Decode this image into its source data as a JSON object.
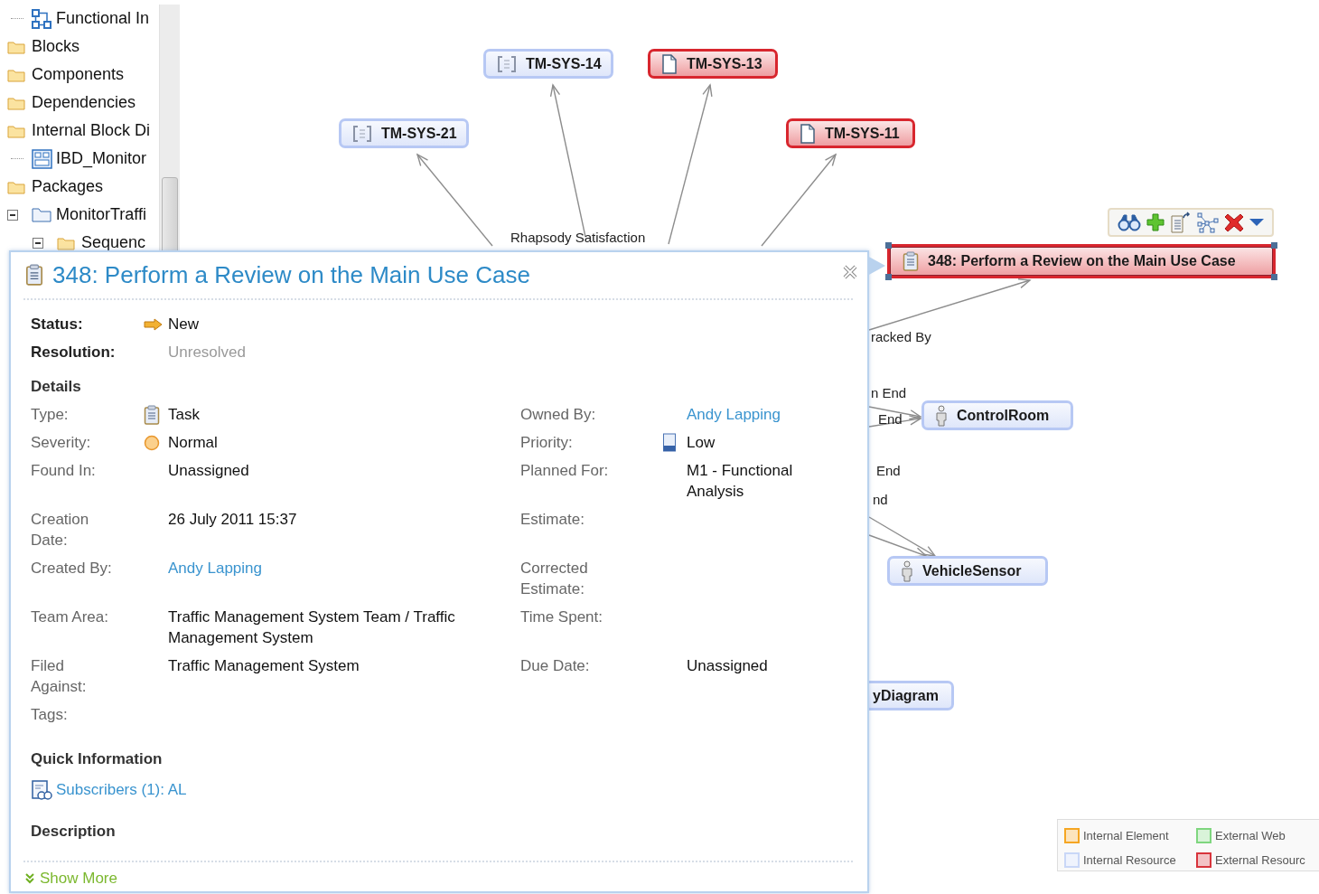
{
  "project_tree": {
    "leading_children": [
      {
        "label": "Functional In",
        "kind": "diagram"
      }
    ],
    "items": [
      {
        "label": "Blocks",
        "kind": "folder"
      },
      {
        "label": "Components",
        "kind": "folder"
      },
      {
        "label": "Dependencies",
        "kind": "folder"
      },
      {
        "label": "Internal Block Di",
        "kind": "folder",
        "children": [
          {
            "label": "IBD_Monitor",
            "kind": "block_diagram"
          }
        ]
      },
      {
        "label": "Packages",
        "kind": "folder",
        "children": [
          {
            "label": "MonitorTraffi",
            "kind": "package",
            "expanded": true,
            "children": [
              {
                "label": "Sequenc",
                "kind": "folder",
                "expanded": true
              }
            ]
          }
        ]
      }
    ]
  },
  "diagram": {
    "nodes": [
      {
        "label": "TM-SYS-14",
        "kind": "requirement",
        "color": "#b7c8f4",
        "selected": false
      },
      {
        "label": "TM-SYS-13",
        "kind": "document",
        "color": "#d8262e",
        "selected": false
      },
      {
        "label": "TM-SYS-21",
        "kind": "requirement",
        "color": "#b7c8f4",
        "selected": false
      },
      {
        "label": "TM-SYS-11",
        "kind": "document",
        "color": "#d8262e",
        "selected": false
      },
      {
        "label": "348: Perform a Review on the Main Use Case",
        "kind": "task",
        "color": "#d8262e",
        "selected": true
      },
      {
        "label": "ControlRoom",
        "kind": "actor",
        "color": "#b7c8f4",
        "selected": false
      },
      {
        "label": "VehicleSensor",
        "kind": "actor",
        "color": "#b7c8f4",
        "selected": false
      },
      {
        "label": "yDiagram",
        "kind": "hidden",
        "color": "#b7c8f4",
        "selected": false
      }
    ],
    "edge_labels": [
      "Rhapsody Satisfaction",
      "racked By",
      "n End",
      "End",
      "End",
      "nd"
    ],
    "legend": [
      {
        "label": "Internal Element",
        "color": "#f5a623"
      },
      {
        "label": "External Web",
        "color": "#7fd67f"
      },
      {
        "label": "Internal Resource",
        "color": "#c9d7f7"
      },
      {
        "label": "External Resourc",
        "color": "#d8343c"
      }
    ]
  },
  "popup": {
    "title": "348: Perform a Review on the Main Use Case",
    "status_fields": [
      {
        "label": "Status:",
        "value": "New",
        "kind": "status"
      },
      {
        "label": "Resolution:",
        "value": "Unresolved",
        "kind": "muted"
      }
    ],
    "details": {
      "heading": "Details",
      "left": [
        {
          "label": "Type:",
          "value": "Task",
          "kind": "type"
        },
        {
          "label": "Severity:",
          "value": "Normal",
          "kind": "severity"
        },
        {
          "label": "Found In:",
          "value": "Unassigned",
          "kind": "text"
        },
        {
          "label": "Creation Date:",
          "value": "26 July 2011 15:37",
          "kind": "text"
        },
        {
          "label": "Created By:",
          "value": "Andy Lapping",
          "kind": "link"
        },
        {
          "label": "Team Area:",
          "value": "Traffic Management System Team / Traffic Management System",
          "kind": "text"
        },
        {
          "label": "Filed Against:",
          "value": "Traffic Management System",
          "kind": "text"
        },
        {
          "label": "Tags:",
          "kind": "text"
        }
      ],
      "right": [
        {
          "label": "Owned By:",
          "value": "Andy Lapping",
          "kind": "link"
        },
        {
          "label": "Priority:",
          "value": "Low",
          "kind": "priority"
        },
        {
          "label": "Planned For:",
          "value": "M1 - Functional Analysis",
          "kind": "text"
        },
        {
          "label": "Estimate:",
          "kind": "text"
        },
        {
          "label": "Corrected Estimate:",
          "kind": "text"
        },
        {
          "label": "Time Spent:",
          "kind": "text"
        },
        {
          "label": "Due Date:",
          "value": "Unassigned",
          "kind": "text"
        }
      ]
    },
    "quick_info": {
      "heading": "Quick Information",
      "subscribers": "Subscribers (1): AL"
    },
    "description": {
      "heading": "Description"
    },
    "show_more": "Show More"
  }
}
